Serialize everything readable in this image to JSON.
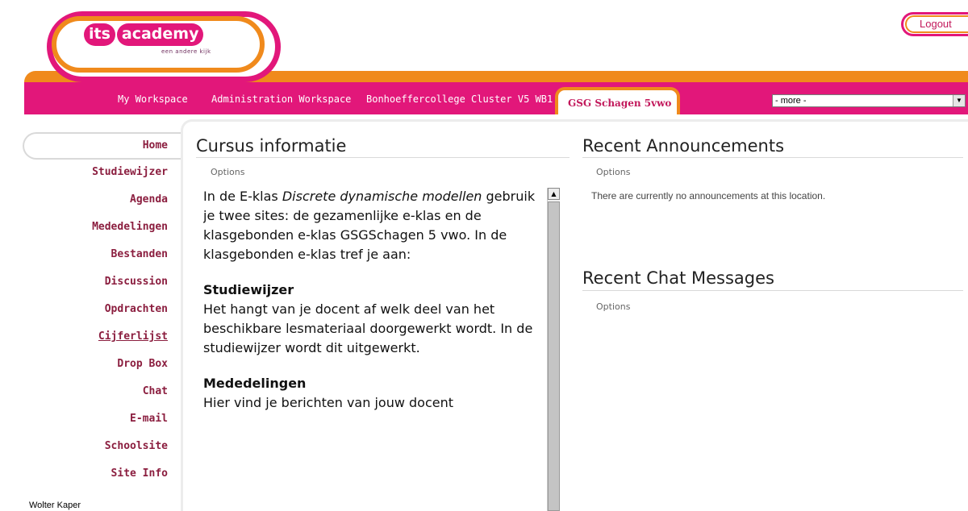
{
  "header": {
    "logo": {
      "words": [
        "its",
        "academy"
      ],
      "tagline": "een andere kijk"
    },
    "logout_label": "Logout",
    "tabs": [
      {
        "label": "My Workspace"
      },
      {
        "label": "Administration Workspace"
      },
      {
        "label": "Bonhoeffercollege Cluster V5 WB1"
      }
    ],
    "active_tab": "GSG Schagen 5vwo",
    "more_select": "- more -"
  },
  "sidebar": {
    "items": [
      {
        "label": "Home"
      },
      {
        "label": "Studiewijzer"
      },
      {
        "label": "Agenda"
      },
      {
        "label": "Mededelingen"
      },
      {
        "label": "Bestanden"
      },
      {
        "label": "Discussion"
      },
      {
        "label": "Opdrachten"
      },
      {
        "label": "Cijferlijst"
      },
      {
        "label": "Drop Box"
      },
      {
        "label": "Chat"
      },
      {
        "label": "E-mail"
      },
      {
        "label": "Schoolsite"
      },
      {
        "label": "Site Info"
      }
    ],
    "user": "Wolter Kaper"
  },
  "course_info": {
    "title": "Cursus informatie",
    "options": "Options",
    "intro_1": "In de E-klas ",
    "intro_em": "Discrete dynamische modellen",
    "intro_2": " gebruik je twee sites: de gezamenlijke e-klas en de klasgebonden e-klas GSGSchagen 5 vwo. In de klasgebonden e-klas tref je aan:",
    "h_studiewijzer": "Studiewijzer",
    "p_studiewijzer": "Het hangt van je docent af welk deel van het beschikbare  lesmateriaal doorgewerkt wordt. In de studiewijzer wordt dit uitgewerkt.",
    "h_mededelingen": "Mededelingen",
    "p_mededelingen": "Hier vind je berichten van jouw docent"
  },
  "announcements": {
    "title": "Recent Announcements",
    "options": "Options",
    "empty": "There are currently no announcements at this location."
  },
  "chat": {
    "title": "Recent Chat Messages",
    "options": "Options"
  },
  "colors": {
    "brand_pink": "#e2177a",
    "brand_orange": "#f08a1c",
    "menu_text": "#8b1e3f"
  }
}
